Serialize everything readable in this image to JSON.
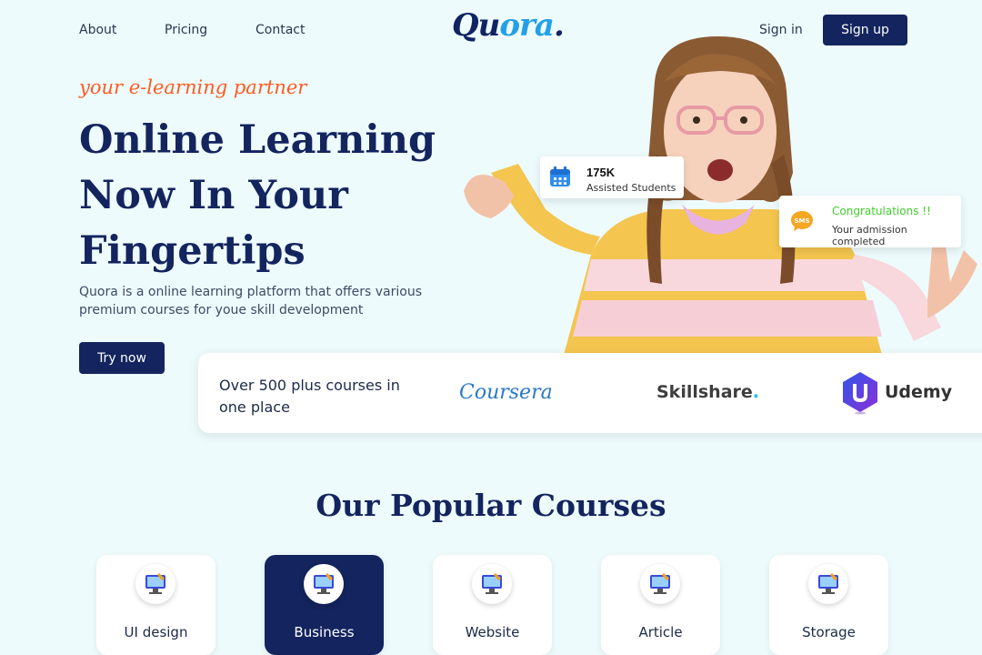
{
  "nav": {
    "links": [
      "About",
      "Pricing",
      "Contact"
    ],
    "logo_main": "Qu",
    "logo_accent": "ora",
    "logo_dot": ".",
    "signin": "Sign in",
    "signup": "Sign up"
  },
  "hero": {
    "tagline": "your e-learning partner",
    "title": "Online Learning Now In Your Fingertips",
    "description": "Quora is a online learning platform that offers various premium courses for youe skill development",
    "cta": "Try now"
  },
  "stat_card": {
    "icon": "calendar-icon",
    "value": "175K",
    "label": "Assisted Students"
  },
  "congrats_card": {
    "icon": "sms-chat-icon",
    "title": "Congratulations !!",
    "subtitle": "Your admission completed"
  },
  "partners": {
    "text": "Over 500 plus courses in one place",
    "coursera": "Coursera",
    "skillshare": "Skillshare",
    "skillshare_dot": ".",
    "udemy": "Udemy"
  },
  "courses": {
    "title": "Our Popular Courses",
    "items": [
      {
        "label": "UI design",
        "active": false
      },
      {
        "label": "Business",
        "active": true
      },
      {
        "label": "Website",
        "active": false
      },
      {
        "label": "Article",
        "active": false
      },
      {
        "label": "Storage",
        "active": false
      }
    ]
  },
  "colors": {
    "primary": "#13245e",
    "accent": "#24a0e8",
    "tagline": "#ff5a1f",
    "background": "#eefbfd",
    "success": "#3ecf2a"
  }
}
